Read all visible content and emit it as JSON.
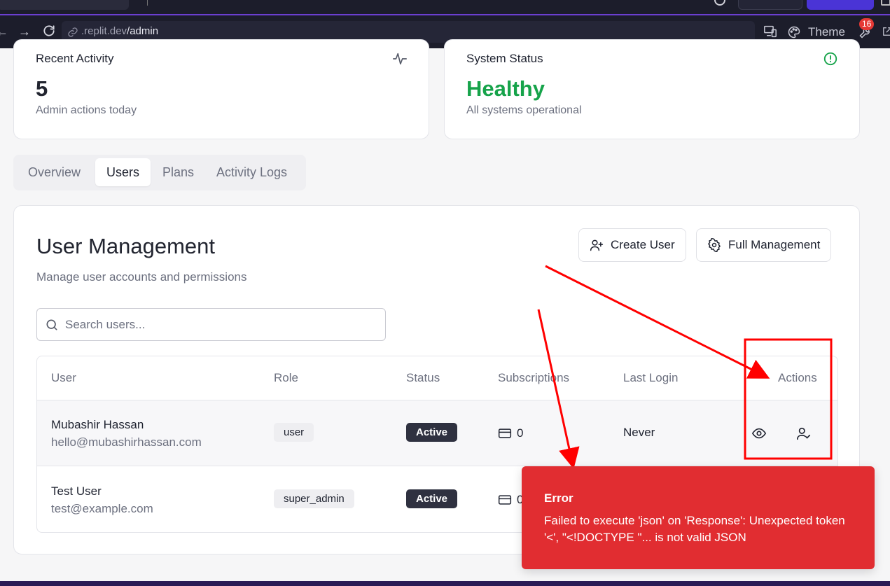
{
  "browser": {
    "url_host": ".replit.dev",
    "url_path": "/admin",
    "theme_label": "Theme",
    "badge_count": "16"
  },
  "stats": {
    "recent_activity": {
      "label": "Recent Activity",
      "value": "5",
      "sub": "Admin actions today"
    },
    "system_status": {
      "label": "System Status",
      "value": "Healthy",
      "sub": "All systems operational",
      "value_color": "#16a34a"
    }
  },
  "tabs": [
    {
      "label": "Overview"
    },
    {
      "label": "Users"
    },
    {
      "label": "Plans"
    },
    {
      "label": "Activity Logs"
    }
  ],
  "user_management": {
    "title": "User Management",
    "description": "Manage user accounts and permissions",
    "create_user_label": "Create User",
    "full_management_label": "Full Management",
    "search_placeholder": "Search users...",
    "columns": [
      "User",
      "Role",
      "Status",
      "Subscriptions",
      "Last Login",
      "Actions"
    ],
    "rows": [
      {
        "name": "Mubashir Hassan",
        "email": "hello@mubashirhassan.com",
        "role": "user",
        "status": "Active",
        "subscriptions": "0",
        "last_login": "Never"
      },
      {
        "name": "Test User",
        "email": "test@example.com",
        "role": "super_admin",
        "status": "Active",
        "subscriptions": "0",
        "last_login": ""
      }
    ]
  },
  "toast": {
    "title": "Error",
    "message": "Failed to execute 'json' on 'Response': Unexpected token '<', \"<!DOCTYPE \"... is not valid JSON"
  },
  "colors": {
    "accent": "#4a34d6",
    "annotation_red": "#ff0000",
    "toast_bg": "#e12d31",
    "status_bg": "#2f3140"
  }
}
